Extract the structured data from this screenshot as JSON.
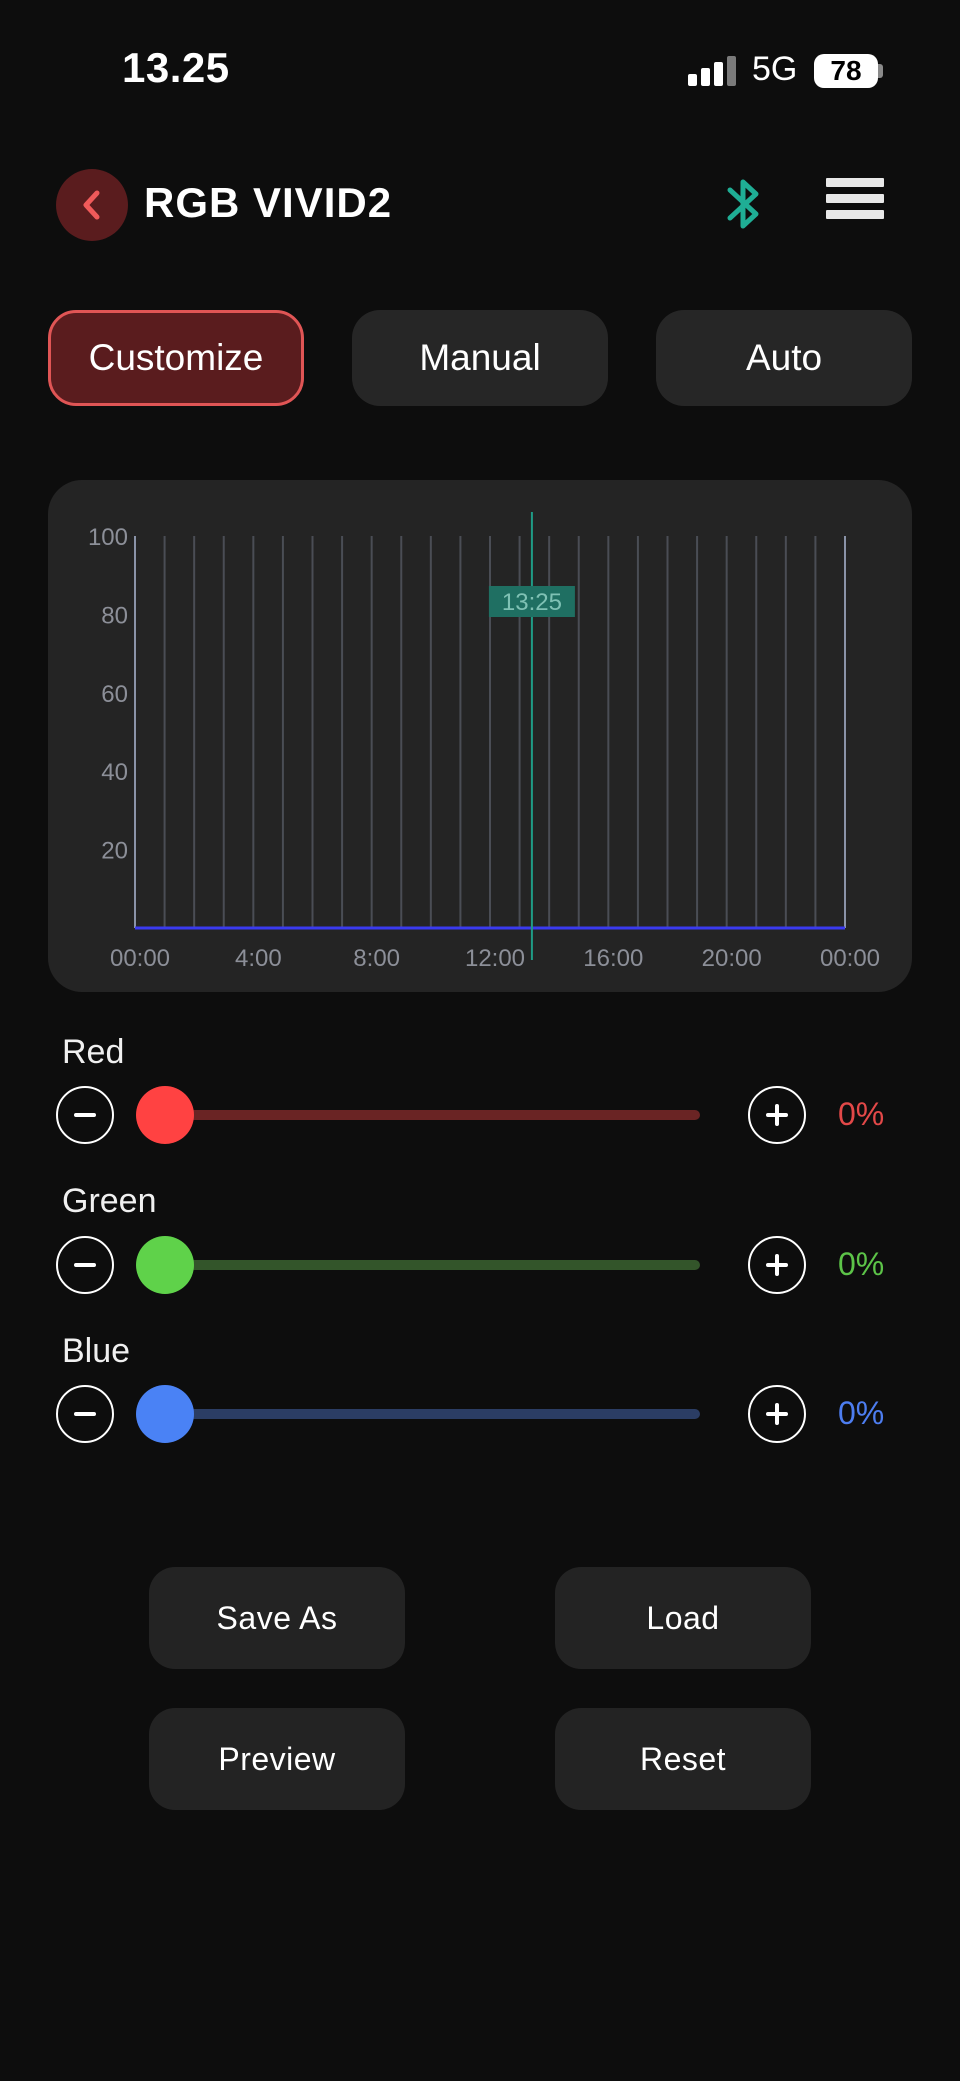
{
  "status_bar": {
    "time": "13.25",
    "network": "5G",
    "battery": "78"
  },
  "header": {
    "title": "RGB VIVID2",
    "back_icon": "chevron-left-icon",
    "bluetooth_icon": "bluetooth-icon",
    "menu_icon": "hamburger-menu-icon"
  },
  "tabs": [
    {
      "label": "Customize",
      "active": true
    },
    {
      "label": "Manual",
      "active": false
    },
    {
      "label": "Auto",
      "active": false
    }
  ],
  "chart_data": {
    "type": "line",
    "title": "",
    "xlabel": "",
    "ylabel": "",
    "x_tick_labels": [
      "00:00",
      "4:00",
      "8:00",
      "12:00",
      "16:00",
      "20:00",
      "00:00"
    ],
    "y_tick_labels": [
      "100",
      "80",
      "60",
      "40",
      "20"
    ],
    "ylim": [
      0,
      100
    ],
    "xlim_hours": [
      0,
      24
    ],
    "grid_x_interval_hours": 1,
    "current_time_marker": {
      "label": "13:25",
      "hour": 13.4167,
      "color": "#1f9b86"
    },
    "series": [
      {
        "color": "#3a3af0",
        "x_hours": [
          0,
          24
        ],
        "values": [
          0,
          0
        ]
      }
    ]
  },
  "channels": [
    {
      "label": "Red",
      "value": 0,
      "percent_text": "0%",
      "color": "#ff4242",
      "track_color": "#6a2424",
      "text_color": "#e24848"
    },
    {
      "label": "Green",
      "value": 0,
      "percent_text": "0%",
      "color": "#5fd24a",
      "track_color": "#33552a",
      "text_color": "#5cc348"
    },
    {
      "label": "Blue",
      "value": 0,
      "percent_text": "0%",
      "color": "#4a82f5",
      "track_color": "#2b3d64",
      "text_color": "#4d7df0"
    }
  ],
  "buttons": {
    "save_as": "Save As",
    "load": "Load",
    "preview": "Preview",
    "reset": "Reset"
  },
  "colors": {
    "background": "#0d0d0d",
    "card": "#242424",
    "accent_red": "#e05555",
    "bluetooth": "#1fae95"
  }
}
